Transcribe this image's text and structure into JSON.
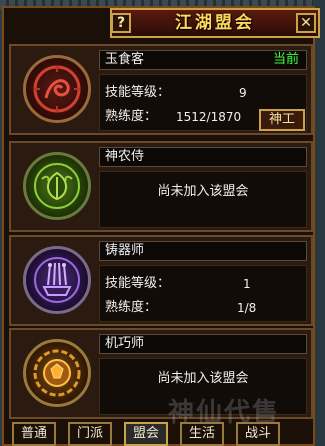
{
  "window": {
    "title": "江湖盟会",
    "help_label": "?",
    "close_label": "✕"
  },
  "cards": [
    {
      "name": "玉食客",
      "status": "当前",
      "skill_level_label": "技能等级：",
      "skill_level": "9",
      "proficiency_label": "熟练度：",
      "proficiency": "1512/1870",
      "action_label": "神工",
      "icon": "feast-emblem-icon",
      "accent": "#c0392b"
    },
    {
      "name": "神农侍",
      "message": "尚未加入该盟会",
      "icon": "herb-emblem-icon",
      "accent": "#7ab82a"
    },
    {
      "name": "铸器师",
      "skill_level_label": "技能等级：",
      "skill_level": "1",
      "proficiency_label": "熟练度：",
      "proficiency": "1/8",
      "icon": "forge-emblem-icon",
      "accent": "#8a4ad0"
    },
    {
      "name": "机巧师",
      "message": "尚未加入该盟会",
      "icon": "gear-emblem-icon",
      "accent": "#e08a1a"
    }
  ],
  "tabs": [
    "普通",
    "门派",
    "盟会",
    "生活",
    "战斗"
  ],
  "active_tab": "盟会",
  "watermark": "神仙代售"
}
